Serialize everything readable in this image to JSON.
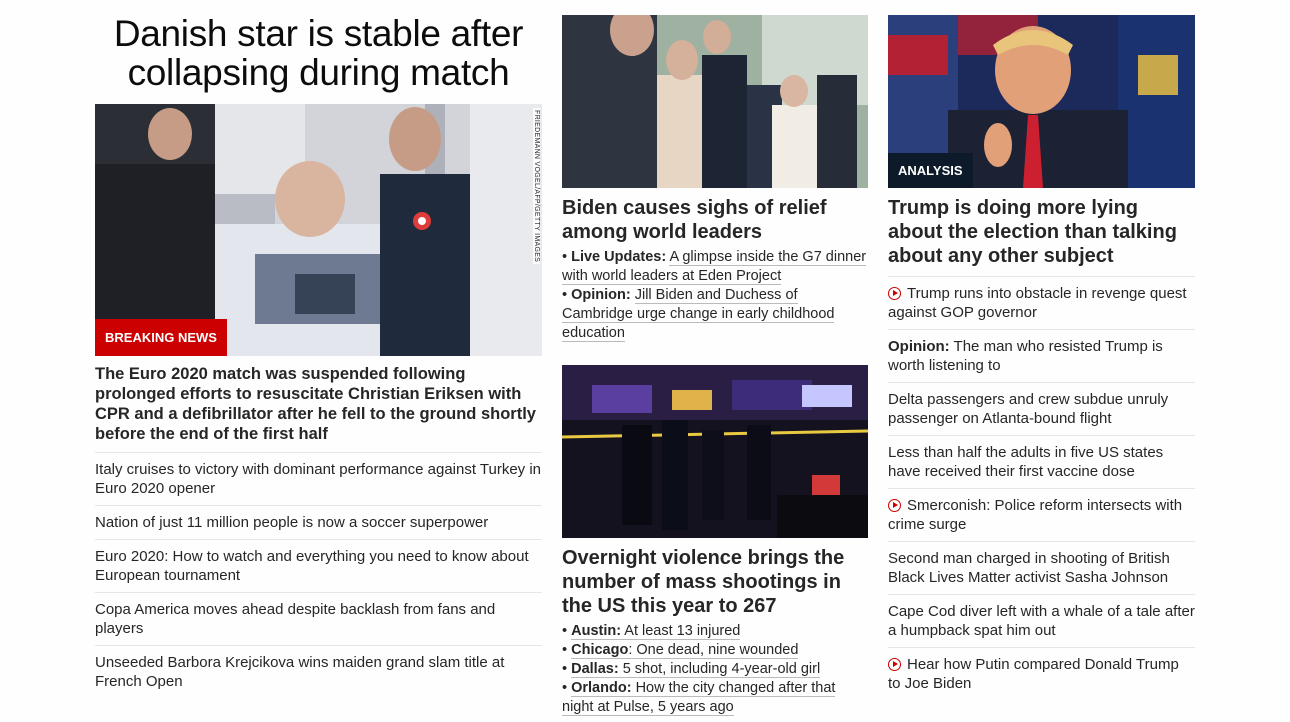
{
  "col1": {
    "headline": "Danish star is stable after collapsing during match",
    "badge": "BREAKING NEWS",
    "photo_credit": "FRIEDEMANN VOGEL/AFP/GETTY IMAGES",
    "lead": "The Euro 2020 match was suspended following prolonged efforts to resuscitate Christian Eriksen with CPR and a defibrillator after he fell to the ground shortly before the end of the first half",
    "links": [
      "Italy cruises to victory with dominant performance against Turkey in Euro 2020 opener",
      "Nation of just 11 million people is now a soccer superpower",
      "Euro 2020: How to watch and everything you need to know about European tournament",
      "Copa America moves ahead despite backlash from fans and players",
      "Unseeded Barbora Krejcikova wins maiden grand slam title at French Open"
    ]
  },
  "col2": {
    "card1": {
      "title": "Biden causes sighs of relief among world leaders",
      "bullets": [
        {
          "label": "Live Updates:",
          "text": "A glimpse inside the G7 dinner with world leaders at Eden Project"
        },
        {
          "label": "Opinion:",
          "text": "Jill Biden and Duchess of Cambridge urge change in early childhood education"
        }
      ]
    },
    "card2": {
      "title": "Overnight violence brings the number of mass shootings in the US this year to 267",
      "bullets": [
        {
          "label": "Austin:",
          "text": "At least 13 injured"
        },
        {
          "label": "Chicago",
          "text": ": One dead, nine wounded"
        },
        {
          "label": "Dallas:",
          "text": "5 shot, including 4-year-old girl"
        },
        {
          "label": "Orlando:",
          "text": "How the city changed after that night at Pulse, 5 years ago"
        }
      ]
    }
  },
  "col3": {
    "badge": "ANALYSIS",
    "title": "Trump is doing more lying about the election than talking about any other subject",
    "links": [
      {
        "video": true,
        "label": "",
        "text": "Trump runs into obstacle in revenge quest against GOP governor"
      },
      {
        "video": false,
        "label": "Opinion:",
        "text": " The man who resisted Trump is worth listening to"
      },
      {
        "video": false,
        "label": "",
        "text": "Delta passengers and crew subdue unruly passenger on Atlanta-bound flight"
      },
      {
        "video": false,
        "label": "",
        "text": "Less than half the adults in five US states have received their first vaccine dose"
      },
      {
        "video": true,
        "label": "",
        "text": "Smerconish: Police reform intersects with crime surge"
      },
      {
        "video": false,
        "label": "",
        "text": "Second man charged in shooting of British Black Lives Matter activist Sasha Johnson"
      },
      {
        "video": false,
        "label": "",
        "text": "Cape Cod diver left with a whale of a tale after a humpback spat him out"
      },
      {
        "video": true,
        "label": "",
        "text": "Hear how Putin compared Donald Trump to Joe Biden"
      }
    ]
  },
  "colors": {
    "accent_red": "#cc0000",
    "text": "#262626",
    "divider": "#e6e6e6"
  }
}
